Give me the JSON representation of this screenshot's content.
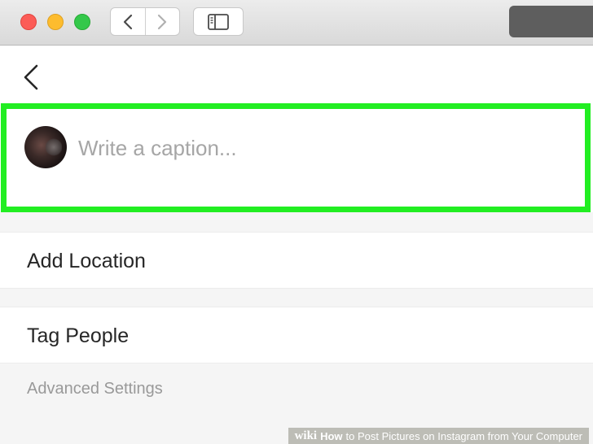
{
  "browser": {
    "traffic_lights": {
      "close_color": "#fc5c57",
      "minimize_color": "#fdbc2e",
      "zoom_color": "#34c84a"
    },
    "icons": {
      "back": "chevron-left-icon",
      "forward": "chevron-right-icon",
      "sidebar": "sidebar-icon"
    }
  },
  "app": {
    "icons": {
      "back": "back-arrow-icon"
    },
    "caption": {
      "placeholder": "Write a caption...",
      "value": "",
      "highlight_color": "#22ee22"
    },
    "rows": {
      "add_location": "Add Location",
      "tag_people": "Tag People"
    },
    "advanced_settings": "Advanced Settings"
  },
  "watermark": {
    "wiki": "wiki",
    "how": "How",
    "rest": "to Post Pictures on Instagram from Your Computer"
  }
}
